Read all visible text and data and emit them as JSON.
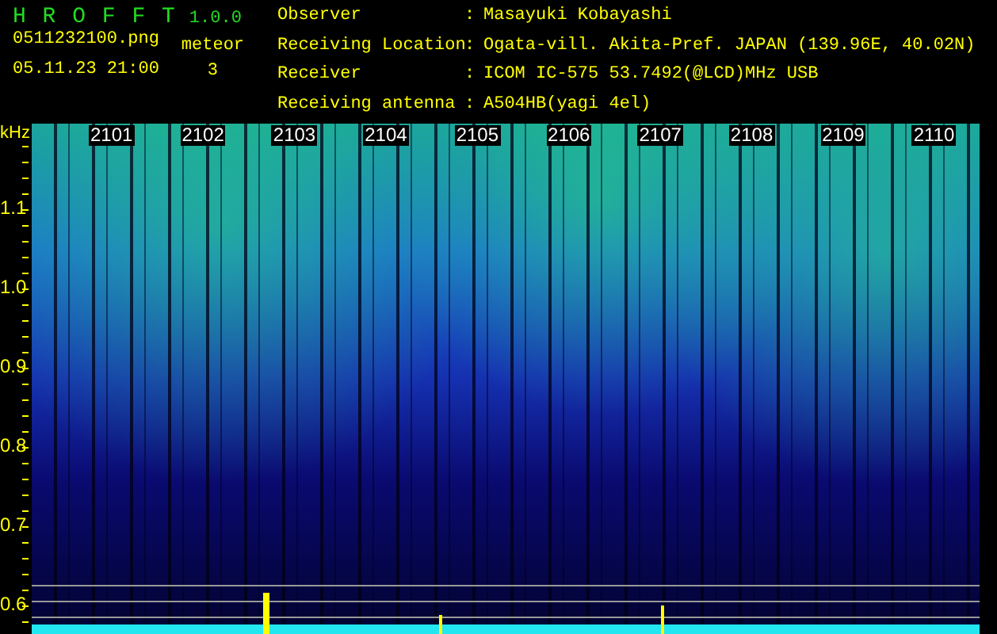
{
  "app": {
    "name": "H R O F F T",
    "version": "1.0.0"
  },
  "file": "0511232100.png",
  "datetime": "05.11.23 21:00",
  "meteor": {
    "label": "meteor",
    "count": "3"
  },
  "info": [
    {
      "label": "Observer",
      "separator": ":",
      "value": "Masayuki Kobayashi"
    },
    {
      "label": "Receiving Location",
      "separator": ":",
      "value": "Ogata-vill. Akita-Pref. JAPAN (139.96E, 40.02N)"
    },
    {
      "label": "Receiver",
      "separator": ":",
      "value": "ICOM IC-575 53.7492(@LCD)MHz USB"
    },
    {
      "label": "Receiving antenna",
      "separator": ":",
      "value": "A504HB(yagi 4el)"
    }
  ],
  "y_axis": {
    "unit": "kHz",
    "labels": [
      "1.1",
      "1.0",
      "0.9",
      "0.8",
      "0.7",
      "0.6"
    ]
  },
  "time_labels": [
    "2101",
    "2102",
    "2103",
    "2104",
    "2105",
    "2106",
    "2107",
    "2108",
    "2109",
    "2110"
  ]
}
